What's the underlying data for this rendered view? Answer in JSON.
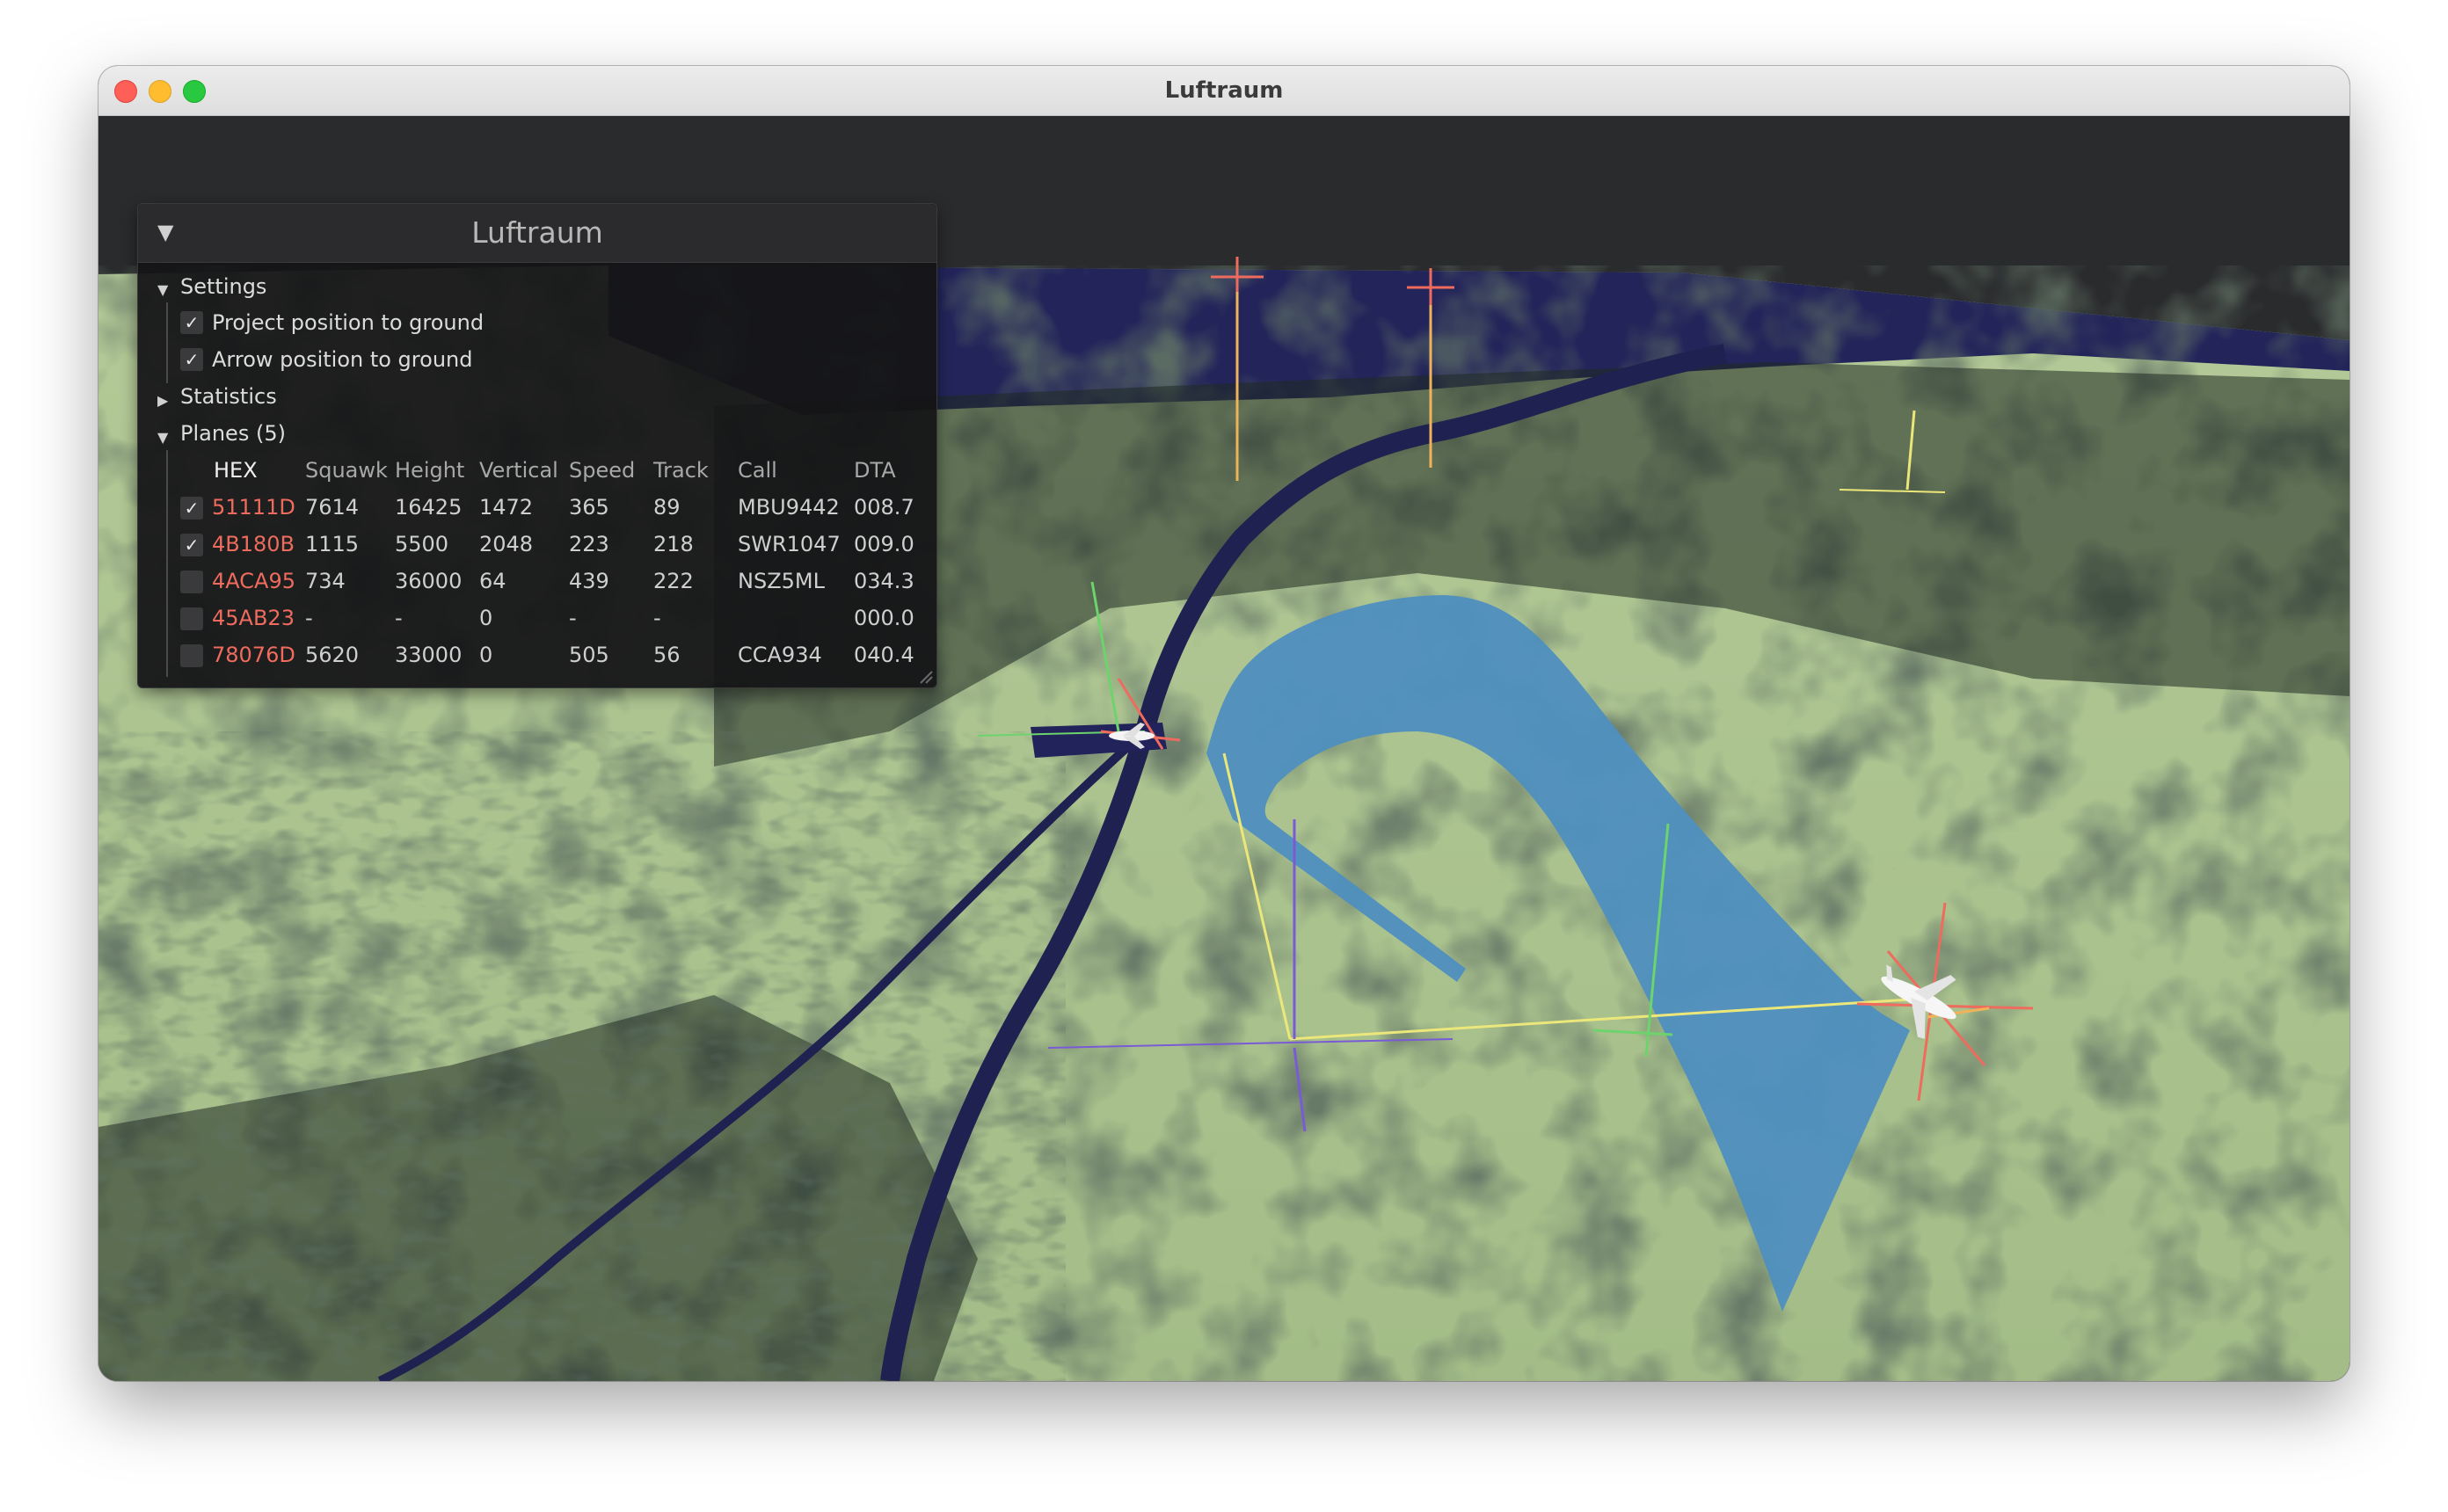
{
  "window": {
    "title": "Luftraum"
  },
  "panel": {
    "title": "Luftraum",
    "collapse_glyph": "▼",
    "settings": {
      "label": "Settings",
      "expanded": true,
      "options": [
        {
          "label": "Project position to ground",
          "checked": true
        },
        {
          "label": "Arrow position to ground",
          "checked": true
        }
      ]
    },
    "statistics": {
      "label": "Statistics",
      "expanded": false
    },
    "planes": {
      "label": "Planes (5)",
      "expanded": true,
      "columns": [
        "HEX",
        "Squawk",
        "Height",
        "Vertical",
        "Speed",
        "Track",
        "Call",
        "DTA"
      ],
      "rows": [
        {
          "checked": true,
          "hex": "51111D",
          "squawk": "7614",
          "height": "16425",
          "vertical": "1472",
          "speed": "365",
          "track": "89",
          "call": "MBU9442",
          "dta": "008.7"
        },
        {
          "checked": true,
          "hex": "4B180B",
          "squawk": "1115",
          "height": "5500",
          "vertical": "2048",
          "speed": "223",
          "track": "218",
          "call": "SWR1047",
          "dta": "009.0"
        },
        {
          "checked": false,
          "hex": "4ACA95",
          "squawk": "734",
          "height": "36000",
          "vertical": "64",
          "speed": "439",
          "track": "222",
          "call": "NSZ5ML",
          "dta": "034.3"
        },
        {
          "checked": false,
          "hex": "45AB23",
          "squawk": "-",
          "height": "-",
          "vertical": "0",
          "speed": "-",
          "track": "-",
          "call": "",
          "dta": "000.0"
        },
        {
          "checked": false,
          "hex": "78076D",
          "squawk": "5620",
          "height": "33000",
          "vertical": "0",
          "speed": "505",
          "track": "56",
          "call": "CCA934",
          "dta": "040.4"
        }
      ]
    }
  },
  "icons": {
    "check": "✓",
    "tree_expanded": "▼",
    "tree_collapsed": "▶"
  },
  "colors": {
    "terrain": "#a8c08c",
    "forest": "#1f2a22",
    "water": "#1f2150",
    "sky": "#2a2b2d",
    "flight_path": "#4f8fc0",
    "hex_text": "#ee6b5e"
  }
}
